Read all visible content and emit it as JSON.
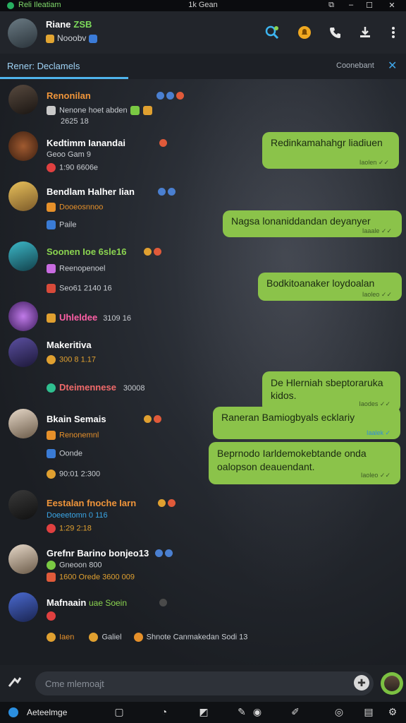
{
  "titlebar": {
    "app_name": "Reli Ileatiam",
    "title": "1k Gean",
    "buttons": [
      "⧉",
      "–",
      "☐",
      "✕"
    ]
  },
  "header": {
    "name": "Riane",
    "name_tag": "ZSB",
    "subtitle": "Nooobv",
    "actions": [
      "search-add-icon",
      "bell-icon",
      "phone-icon",
      "download-icon",
      "more-icon"
    ]
  },
  "tabbar": {
    "active_tab": "Rener: Declamels",
    "right_label": "Coonebant",
    "close": "✕"
  },
  "contacts": [
    {
      "name": "Renonilan",
      "name_color": "#f0953a",
      "line1": "Nenone hoet abden",
      "line2": "2625  18",
      "icon1": "#c9c9c9",
      "icon2": "#e05a3a"
    },
    {
      "name": "Kedtimm Ianandai",
      "name_color": "#ffffff",
      "line1": "Geoo Gam  9",
      "line2": "1:90  6606e",
      "icon1": "",
      "icon2": "#e04040"
    },
    {
      "name": "Bendlam Halher Iian",
      "name_color": "#ffffff",
      "line1": "Dooeosnnoo",
      "line2": "Paile",
      "icon1": "#e6902a",
      "icon2": "#3a7bd5"
    },
    {
      "name": "Soonen Ioe 6sle16",
      "name_color": "#8bd450",
      "line1": "Reenopenoel",
      "line2": "Seo61   2140  16",
      "icon1": "#c86be0",
      "icon2": "#d84a3a"
    },
    {
      "name": "Uhleldee",
      "name_color": "#ff5fa6",
      "line1": "",
      "line2": "",
      "extra": "3109  16",
      "icon1": "#e0a030",
      "icon2": ""
    },
    {
      "name": "Makeritiva",
      "name_color": "#ffffff",
      "line1": "300  8  1.17",
      "line2": "",
      "icon1": "#e0a030",
      "icon2": ""
    },
    {
      "name": "Dteimennese",
      "name_color": "#f06a6a",
      "line1": "",
      "line2": "",
      "extra": "30008",
      "icon1": "#2fbf8f",
      "icon2": ""
    },
    {
      "name": "Bkain Semais",
      "name_color": "#ffffff",
      "line1": "Renonemnl",
      "line2": "Oonde",
      "line3": "90:01   2:300",
      "icon1": "#e6902a",
      "icon2": "#3a7bd5"
    },
    {
      "name": "Eestalan fnoche Iarn",
      "name_color": "#f0953a",
      "line1": "Doeeetomn  0  116",
      "line2": "1:29  2:18",
      "icon1": "",
      "icon2": "#e04040"
    },
    {
      "name": "Grefnr Barino bonjeo13",
      "name_color": "#ffffff",
      "line1": "Gneoon  800",
      "line2": "1600  Orede  3600  009",
      "icon1": "#7ac943",
      "icon2": "#e05a3a"
    },
    {
      "name": "Mafnaain",
      "name_color": "#ffffff",
      "name_tag": "uae Soein",
      "line1": "",
      "line2": "",
      "icon1": "#e04040",
      "icon2": ""
    }
  ],
  "footer_row": {
    "a": "Iaen",
    "b": "Galiel",
    "c": "Shnote Canmakedan Sodi 13"
  },
  "bubbles": [
    {
      "text": "Redinkamahahgr liadiuen",
      "meta": "Iaolen  ✓✓"
    },
    {
      "text": "Nagsa lonaniddandan deyanyer",
      "meta": "Iaaale  ✓✓"
    },
    {
      "text": "Bodkitoanaker loydoalan",
      "meta": "Iaoleo  ✓✓"
    },
    {
      "text": "De Hlerniah sbeptoraruka kidos.",
      "meta": "Iaodes  ✓✓"
    },
    {
      "text": "Raneran Bamiogbyals ecklariy",
      "meta": "Iaalek  ✓"
    },
    {
      "text": "Beprnodo Iarldemokebtande onda oalopson deauendant.",
      "meta": "Iaoleo  ✓✓"
    }
  ],
  "composer": {
    "placeholder": "Cme mlemoajt"
  },
  "taskbar": {
    "label": "Aeteelmge"
  }
}
